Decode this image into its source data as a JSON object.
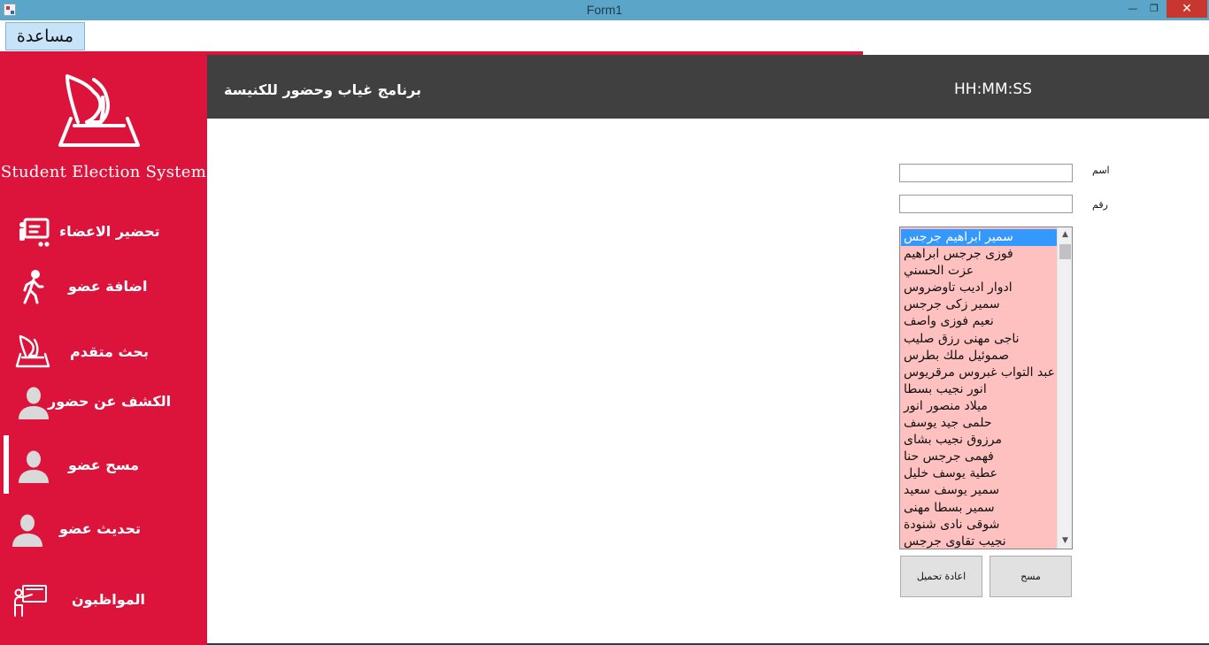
{
  "window": {
    "title": "Form1",
    "minimize_glyph": "—",
    "maximize_glyph": "❐",
    "close_glyph": "✕"
  },
  "menu": {
    "help_label": "مساعدة"
  },
  "sidebar": {
    "brand": "Student Election System",
    "items": [
      {
        "label": "تحضير الاعضاء",
        "icon": "presentation-board-icon"
      },
      {
        "label": "اضافة عضو",
        "icon": "walking-person-icon"
      },
      {
        "label": "بحث متقدم",
        "icon": "ballot-box-icon"
      },
      {
        "label": "الكشف عن حضور",
        "icon": "user-icon"
      },
      {
        "label": "مسح عضو",
        "icon": "user-icon",
        "active": true
      },
      {
        "label": "تحديث عضو",
        "icon": "user-icon"
      },
      {
        "label": "المواظبون",
        "icon": "teacher-board-icon"
      }
    ]
  },
  "header": {
    "title": "برنامج غياب وحضور للكنيسة",
    "clock": "HH:MM:SS"
  },
  "form": {
    "name_label": "اسم",
    "name_value": "",
    "number_label": "رقم",
    "number_value": "",
    "members": [
      "سمير ابراهيم جرجس",
      "فوزى جرجس ابراهيم",
      "عزت الحسني",
      "ادوار اديب تاوضروس",
      "سمير زكى جرجس",
      "نعيم فوزى واصف",
      "ناجى مهنى رزق صليب",
      "صموئيل ملك بطرس",
      "عبد التواب غبروس مرقريوس",
      "انور نجيب بسطا",
      "ميلاد منصور انور",
      "حلمى جيد يوسف",
      "مرزوق نجيب بشاى",
      "فهمى جرجس حنا",
      "عطية يوسف خليل",
      "سمير يوسف سعيد",
      "سمير بسطا مهنى",
      "شوقى نادى شنودة",
      "نجيب تقاوى جرجس"
    ],
    "selected_index": 0,
    "reload_button": "اعادة تحميل",
    "delete_button": "مسح"
  },
  "colors": {
    "sidebar": "#dc143c",
    "header": "#404040",
    "list_bg": "#ffc0c0",
    "selection": "#3399ff"
  }
}
